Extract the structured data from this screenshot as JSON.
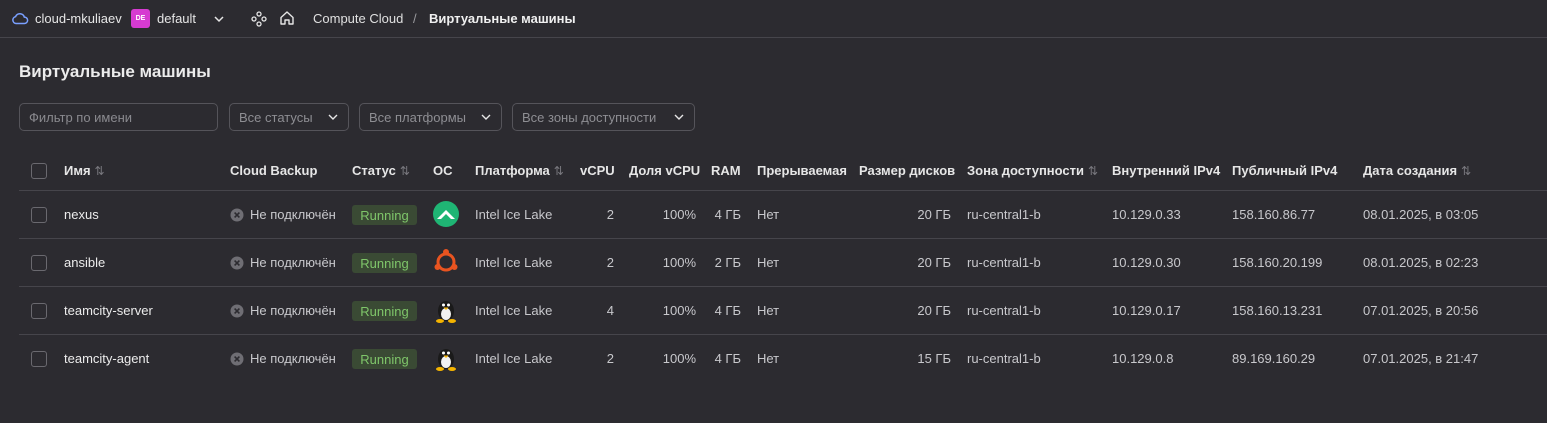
{
  "topbar": {
    "cloud_name": "cloud-mkuliaev",
    "folder_badge": "DE",
    "folder_name": "default",
    "breadcrumb_service": "Compute Cloud",
    "breadcrumb_separator": "/",
    "breadcrumb_current": "Виртуальные машины"
  },
  "page": {
    "title": "Виртуальные машины"
  },
  "filters": {
    "name_placeholder": "Фильтр по имени",
    "status_select": "Все статусы",
    "platform_select": "Все платформы",
    "zone_select": "Все зоны доступности"
  },
  "table": {
    "headers": {
      "name": "Имя",
      "backup": "Cloud Backup",
      "status": "Статус",
      "os": "ОС",
      "platform": "Платформа",
      "vcpu": "vCPU",
      "share": "Доля vCPU",
      "ram": "RAM",
      "preemptible": "Прерываемая",
      "disk": "Размер дисков",
      "zone": "Зона доступности",
      "ip_internal": "Внутренний IPv4",
      "ip_public": "Публичный IPv4",
      "created": "Дата создания"
    },
    "rows": [
      {
        "name": "nexus",
        "backup": "Не подключён",
        "status": "Running",
        "os": "almalinux-icon",
        "platform": "Intel Ice Lake",
        "vcpu": "2",
        "share": "100%",
        "ram": "4 ГБ",
        "preemptible": "Нет",
        "disk": "20 ГБ",
        "zone": "ru-central1-b",
        "ip_internal": "10.129.0.33",
        "ip_public": "158.160.86.77",
        "created": "08.01.2025, в 03:05"
      },
      {
        "name": "ansible",
        "backup": "Не подключён",
        "status": "Running",
        "os": "ubuntu-icon",
        "platform": "Intel Ice Lake",
        "vcpu": "2",
        "share": "100%",
        "ram": "2 ГБ",
        "preemptible": "Нет",
        "disk": "20 ГБ",
        "zone": "ru-central1-b",
        "ip_internal": "10.129.0.30",
        "ip_public": "158.160.20.199",
        "created": "08.01.2025, в 02:23"
      },
      {
        "name": "teamcity-server",
        "backup": "Не подключён",
        "status": "Running",
        "os": "linux-tux-icon",
        "platform": "Intel Ice Lake",
        "vcpu": "4",
        "share": "100%",
        "ram": "4 ГБ",
        "preemptible": "Нет",
        "disk": "20 ГБ",
        "zone": "ru-central1-b",
        "ip_internal": "10.129.0.17",
        "ip_public": "158.160.13.231",
        "created": "07.01.2025, в 20:56"
      },
      {
        "name": "teamcity-agent",
        "backup": "Не подключён",
        "status": "Running",
        "os": "linux-tux-icon",
        "platform": "Intel Ice Lake",
        "vcpu": "2",
        "share": "100%",
        "ram": "4 ГБ",
        "preemptible": "Нет",
        "disk": "15 ГБ",
        "zone": "ru-central1-b",
        "ip_internal": "10.129.0.8",
        "ip_public": "89.169.160.29",
        "created": "07.01.2025, в 21:47"
      }
    ]
  },
  "colors": {
    "background": "#2c2b30",
    "folder_badge": "#d63bd1",
    "status_running": "#7fc66a",
    "almalinux": "#1fb574",
    "ubuntu": "#e95420"
  }
}
